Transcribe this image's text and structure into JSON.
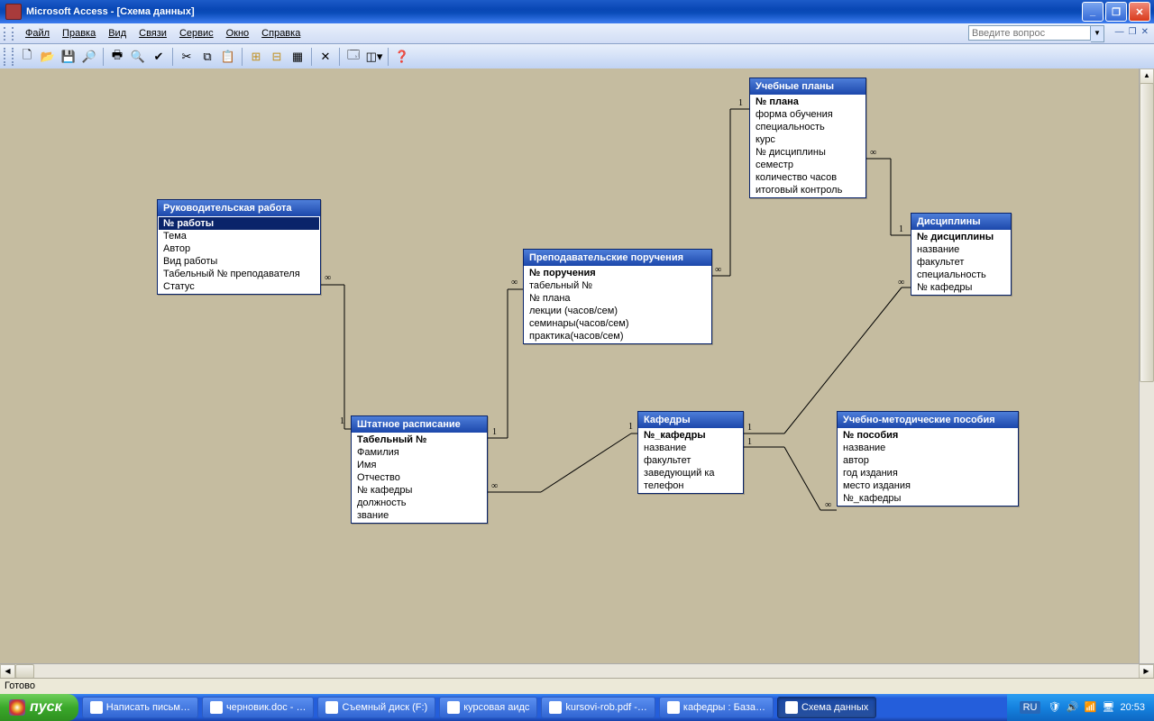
{
  "title": "Microsoft Access - [Схема данных]",
  "menu": [
    "Файл",
    "Правка",
    "Вид",
    "Связи",
    "Сервис",
    "Окно",
    "Справка"
  ],
  "question_placeholder": "Введите вопрос",
  "status": "Готово",
  "tables": {
    "rukovod": {
      "title": "Руководительская работа",
      "fields": [
        {
          "t": "№ работы",
          "pk": true,
          "sel": true
        },
        {
          "t": "Тема"
        },
        {
          "t": "Автор"
        },
        {
          "t": "Вид работы"
        },
        {
          "t": "Табельный № преподавателя"
        },
        {
          "t": "Статус"
        }
      ]
    },
    "prepod": {
      "title": "Преподавательские поручения",
      "fields": [
        {
          "t": "№ поручения",
          "pk": true
        },
        {
          "t": "табельный №"
        },
        {
          "t": "№ плана"
        },
        {
          "t": "лекции (часов/сем)"
        },
        {
          "t": "семинары(часов/сем)"
        },
        {
          "t": "практика(часов/сем)"
        }
      ]
    },
    "plany": {
      "title": "Учебные планы",
      "fields": [
        {
          "t": "№ плана",
          "pk": true
        },
        {
          "t": "форма обучения"
        },
        {
          "t": "специальность"
        },
        {
          "t": "курс"
        },
        {
          "t": "№ дисциплины"
        },
        {
          "t": "семестр"
        },
        {
          "t": "количество часов"
        },
        {
          "t": "итоговый контроль"
        }
      ]
    },
    "disc": {
      "title": "Дисциплины",
      "fields": [
        {
          "t": "№ дисциплины",
          "pk": true
        },
        {
          "t": "название"
        },
        {
          "t": "факультет"
        },
        {
          "t": "специальность"
        },
        {
          "t": "№ кафедры"
        }
      ]
    },
    "shtat": {
      "title": "Штатное расписание",
      "fields": [
        {
          "t": "Табельный №",
          "pk": true
        },
        {
          "t": "Фамилия"
        },
        {
          "t": "Имя"
        },
        {
          "t": "Отчество"
        },
        {
          "t": "№ кафедры"
        },
        {
          "t": "должность"
        },
        {
          "t": "звание"
        }
      ]
    },
    "kafedry": {
      "title": "Кафедры",
      "fields": [
        {
          "t": "№_кафедры",
          "pk": true
        },
        {
          "t": "название"
        },
        {
          "t": "факультет"
        },
        {
          "t": "заведующий ка"
        },
        {
          "t": "телефон"
        }
      ]
    },
    "posobiya": {
      "title": "Учебно-методические пособия",
      "fields": [
        {
          "t": "№ пособия",
          "pk": true
        },
        {
          "t": "название"
        },
        {
          "t": "автор"
        },
        {
          "t": "год издания"
        },
        {
          "t": "место издания"
        },
        {
          "t": "№_кафедры"
        }
      ]
    }
  },
  "taskbar": {
    "start": "пуск",
    "items": [
      {
        "t": "Написать письм…"
      },
      {
        "t": "черновик.doc - …"
      },
      {
        "t": "Съемный диск (F:)"
      },
      {
        "t": "курсовая аидс"
      },
      {
        "t": "kursovi-rob.pdf -…"
      },
      {
        "t": "кафедры : База…"
      },
      {
        "t": "Схема данных",
        "active": true
      }
    ],
    "lang": "RU",
    "time": "20:53"
  }
}
